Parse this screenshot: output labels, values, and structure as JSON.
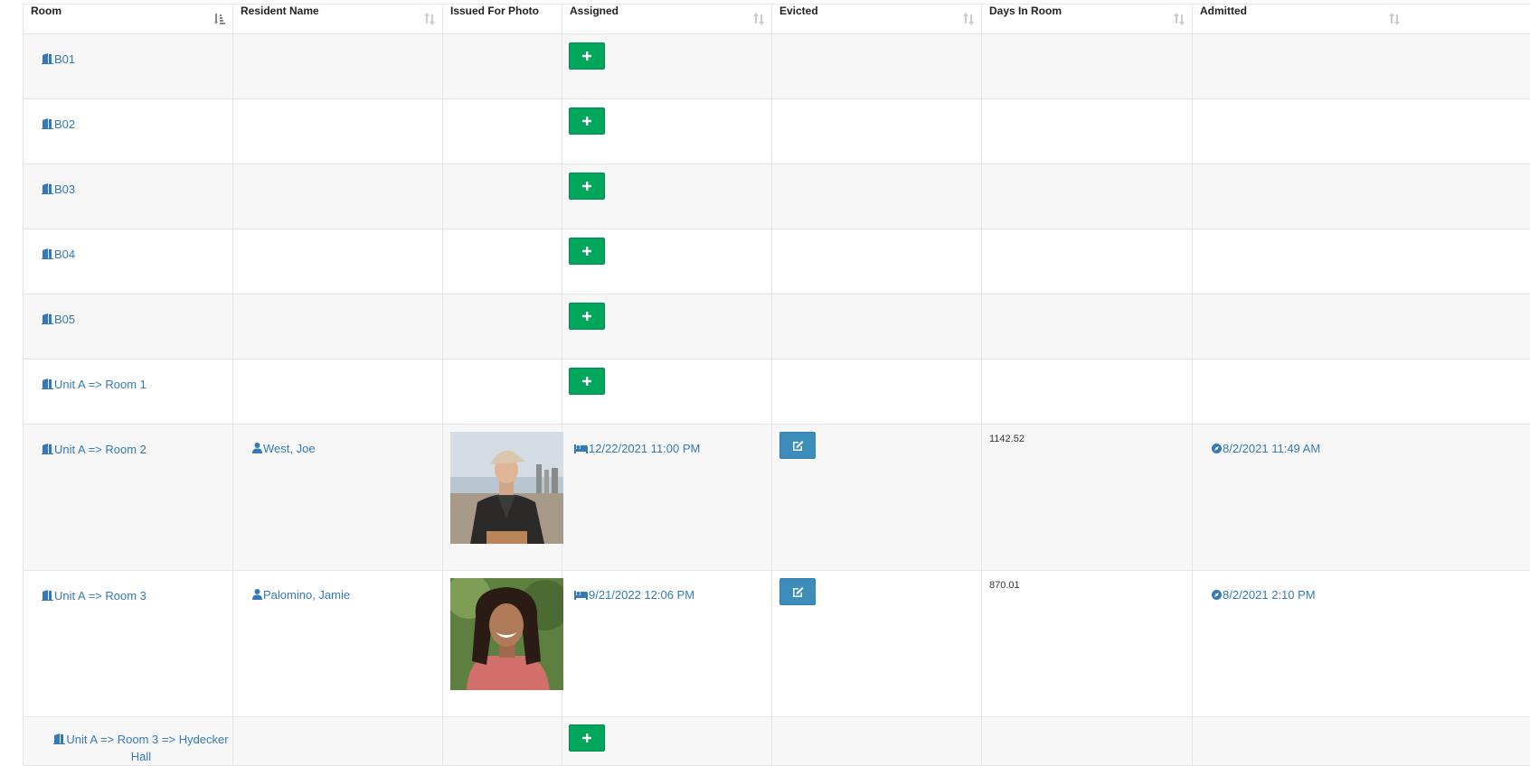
{
  "columns": [
    "Room",
    "Resident Name",
    "Issued For Photo",
    "Assigned",
    "Evicted",
    "Days In Room",
    "Admitted"
  ],
  "rows": [
    {
      "room": "B01"
    },
    {
      "room": "B02"
    },
    {
      "room": "B03"
    },
    {
      "room": "B04"
    },
    {
      "room": "B05"
    },
    {
      "room": "Unit A => Room 1"
    },
    {
      "room": "Unit A => Room 2",
      "resident": "West, Joe",
      "assigned": "12/22/2021 11:00 PM",
      "days": "1142.52",
      "admitted": "8/2/2021 11:49 AM",
      "photo_desc": "young man wearing cap and leather jacket"
    },
    {
      "room": "Unit A => Room 3",
      "resident": "Palomino, Jamie",
      "assigned": "9/21/2022 12:06 PM",
      "days": "870.01",
      "admitted": "8/2/2021 2:10 PM",
      "photo_desc": "smiling young woman with curly hair"
    },
    {
      "room": "Unit A => Room 3 => Hydecker Hall"
    }
  ],
  "colors": {
    "link": "#337ab7",
    "add_button": "#00a65a",
    "edit_button": "#3c8dbc",
    "stripe": "#f7f7f7",
    "border": "#e7e7e7"
  },
  "icons": {
    "room": "door-open-icon",
    "resident": "user-icon",
    "assigned": "bed-icon",
    "admitted": "compass-icon",
    "add": "plus-icon",
    "edit": "edit-icon",
    "sort": "sort-icon"
  }
}
